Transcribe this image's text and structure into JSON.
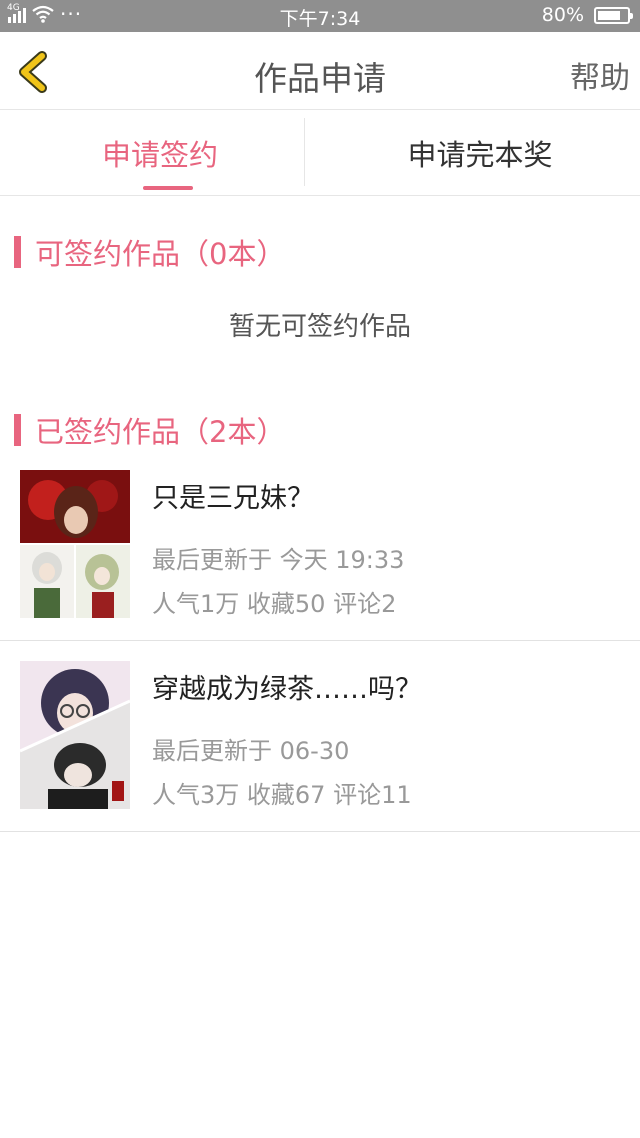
{
  "status_bar": {
    "network": "4G",
    "dots": "···",
    "time": "下午7:34",
    "battery_text": "80%",
    "battery_level": 0.8,
    "icons": [
      "signal-icon",
      "wifi-icon",
      "battery-icon"
    ]
  },
  "header": {
    "back_icon": "chevron-left-icon",
    "title": "作品申请",
    "help_label": "帮助",
    "back_color": "#f0c419"
  },
  "tabs": [
    {
      "label": "申请签约",
      "active": true
    },
    {
      "label": "申请完本奖",
      "active": false
    }
  ],
  "accent_color": "#e8657f",
  "signable_section": {
    "title": "可签约作品（0本）",
    "empty_text": "暂无可签约作品"
  },
  "signed_section": {
    "title": "已签约作品（2本）",
    "works": [
      {
        "title": "只是三兄妹？",
        "updated": "最后更新于 今天 19:33",
        "stats": "人气1万 收藏50 评论2"
      },
      {
        "title": "穿越成为绿茶……吗？",
        "updated": "最后更新于 06-30",
        "stats": "人气3万 收藏67 评论11"
      }
    ]
  }
}
